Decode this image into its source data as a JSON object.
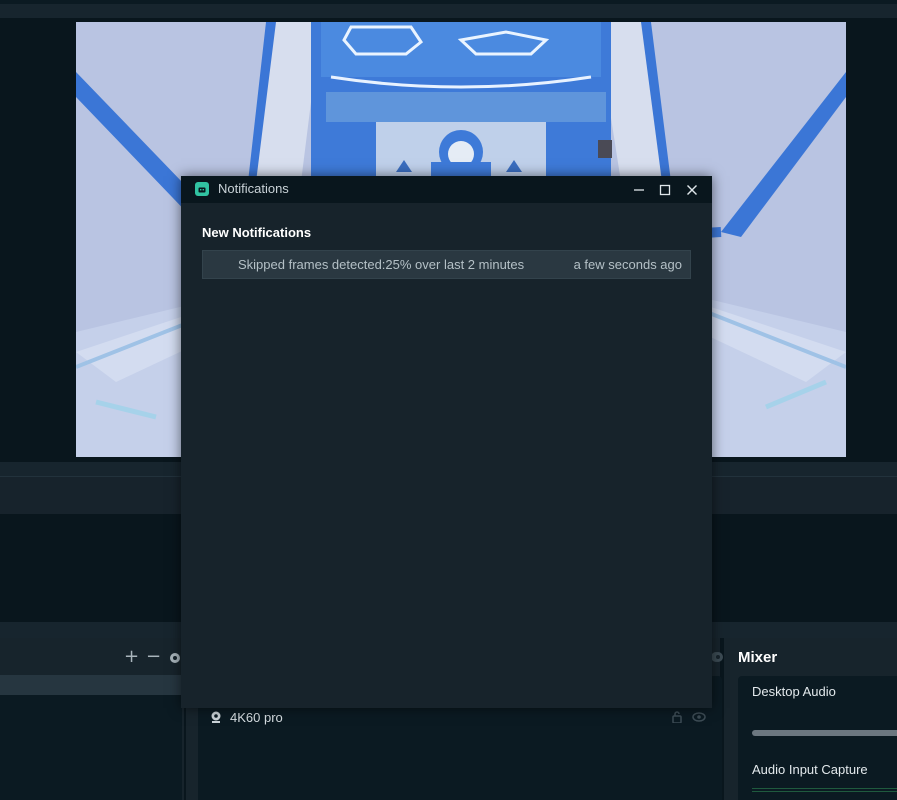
{
  "notifications_dialog": {
    "title": "Notifications",
    "section_heading": "New Notifications",
    "items": [
      {
        "message": "Skipped frames detected:25% over last 2 minutes",
        "time": "a few seconds ago"
      }
    ]
  },
  "scenes": {
    "add_symbol": "+",
    "remove_symbol": "−"
  },
  "sources": {
    "items": [
      {
        "label": "4K60 pro"
      }
    ]
  },
  "mixer": {
    "title": "Mixer",
    "channels": [
      {
        "label": "Desktop Audio"
      },
      {
        "label": "Audio Input Capture"
      }
    ]
  },
  "colors": {
    "app_background": "#09161d",
    "panel_background": "#17242c",
    "accent_teal": "#31c3a2",
    "preview_blue": "#3a7ad8"
  }
}
